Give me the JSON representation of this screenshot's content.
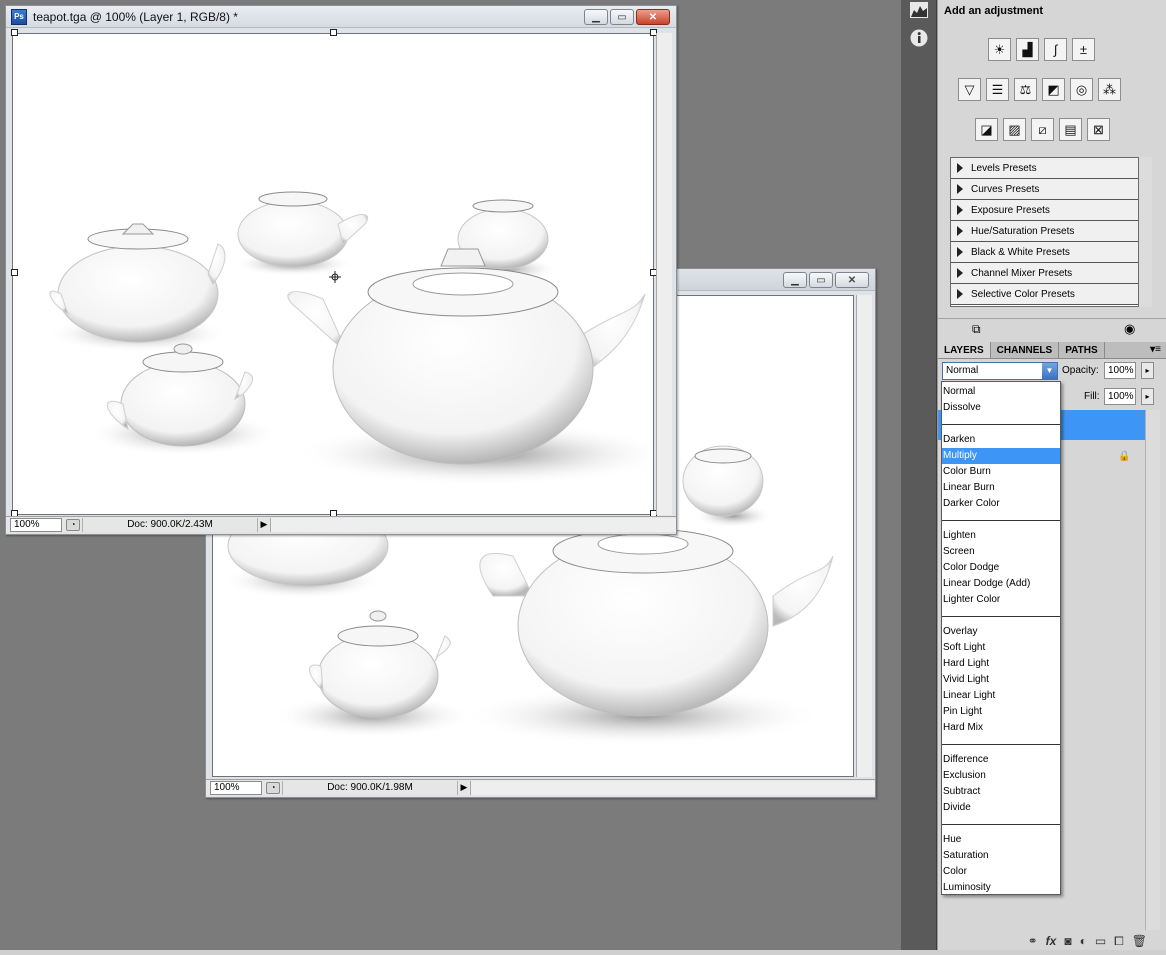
{
  "doc_front": {
    "title": "teapot.tga @ 100% (Layer 1, RGB/8) *",
    "zoom": "100%",
    "doc_info": "Doc: 900.0K/2.43M",
    "app_icon": "Ps"
  },
  "doc_back": {
    "zoom": "100%",
    "doc_info": "Doc: 900.0K/1.98M"
  },
  "adjustments": {
    "title": "Add an adjustment",
    "row1_icons": [
      "brightness-icon",
      "levels-icon",
      "curves-icon",
      "exposure-icon"
    ],
    "row2_icons": [
      "vibrance-icon",
      "hue-saturation-icon",
      "color-balance-icon",
      "black-white-icon",
      "photo-filter-icon",
      "channel-mixer-icon"
    ],
    "row3_icons": [
      "invert-icon",
      "posterize-icon",
      "threshold-icon",
      "gradient-map-icon",
      "selective-color-icon"
    ],
    "presets": [
      "Levels Presets",
      "Curves Presets",
      "Exposure Presets",
      "Hue/Saturation Presets",
      "Black & White Presets",
      "Channel Mixer Presets",
      "Selective Color Presets"
    ]
  },
  "layers_panel": {
    "tabs": [
      "LAYERS",
      "CHANNELS",
      "PATHS"
    ],
    "blend_mode": "Normal",
    "opacity_label": "Opacity:",
    "opacity_value": "100%",
    "fill_label": "Fill:",
    "fill_value": "100%"
  },
  "blend_menu": {
    "groups": [
      [
        "Normal",
        "Dissolve"
      ],
      [
        "Darken",
        "Multiply",
        "Color Burn",
        "Linear Burn",
        "Darker Color"
      ],
      [
        "Lighten",
        "Screen",
        "Color Dodge",
        "Linear Dodge (Add)",
        "Lighter Color"
      ],
      [
        "Overlay",
        "Soft Light",
        "Hard Light",
        "Vivid Light",
        "Linear Light",
        "Pin Light",
        "Hard Mix"
      ],
      [
        "Difference",
        "Exclusion",
        "Subtract",
        "Divide"
      ],
      [
        "Hue",
        "Saturation",
        "Color",
        "Luminosity"
      ]
    ],
    "highlighted": "Multiply"
  },
  "colors": {
    "workspace": "#7b7b7b",
    "highlight": "#3d96f5",
    "close_button": "#c9432a"
  }
}
